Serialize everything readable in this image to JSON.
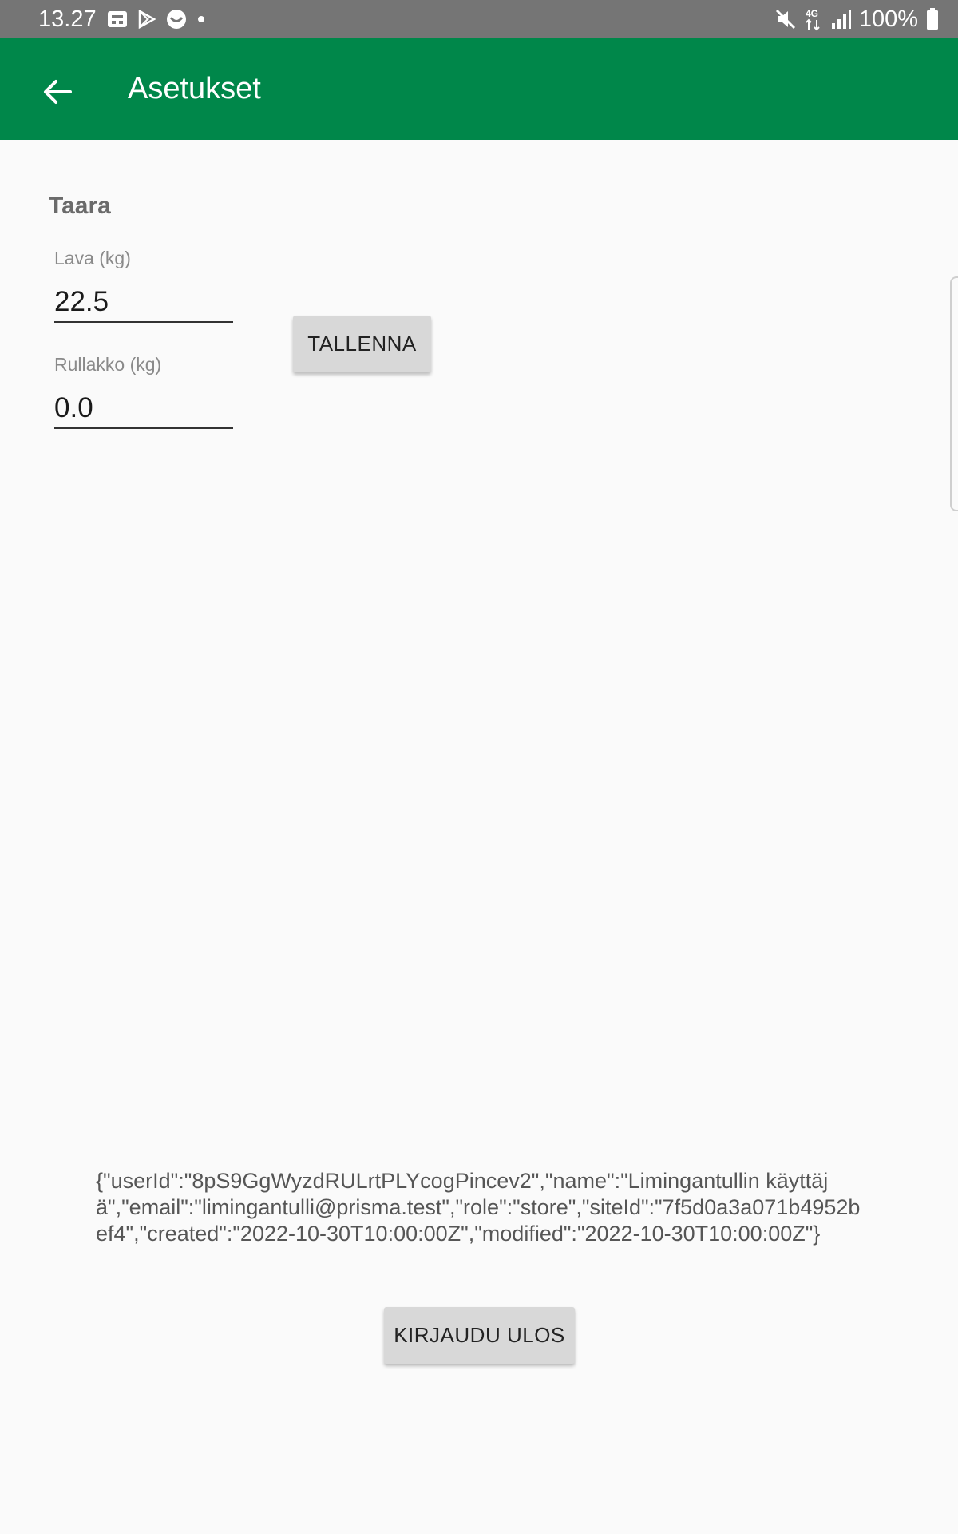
{
  "status_bar": {
    "time": "13.27",
    "battery": "100%",
    "network": "4G",
    "icons": [
      "screenshot-icon",
      "play-store-icon",
      "app-icon",
      "dot-icon",
      "mute-icon",
      "network-4g-icon",
      "signal-icon",
      "battery-icon"
    ]
  },
  "app_bar": {
    "title": "Asetukset",
    "back_icon": "arrow-back-icon",
    "color": "#00874a"
  },
  "section": {
    "title": "Taara"
  },
  "fields": {
    "lava": {
      "label": "Lava (kg)",
      "value": "22.5"
    },
    "rullakko": {
      "label": "Rullakko (kg)",
      "value": "0.0"
    }
  },
  "buttons": {
    "save": "TALLENNA",
    "logout": "KIRJAUDU ULOS"
  },
  "user_json": "{\"userId\":\"8pS9GgWyzdRULrtPLYcogPincev2\",\"name\":\"Limingantullin käyttäjä\",\"email\":\"limingantulli@prisma.test\",\"role\":\"store\",\"siteId\":\"7f5d0a3a071b4952bef4\",\"created\":\"2022-10-30T10:00:00Z\",\"modified\":\"2022-10-30T10:00:00Z\"}"
}
